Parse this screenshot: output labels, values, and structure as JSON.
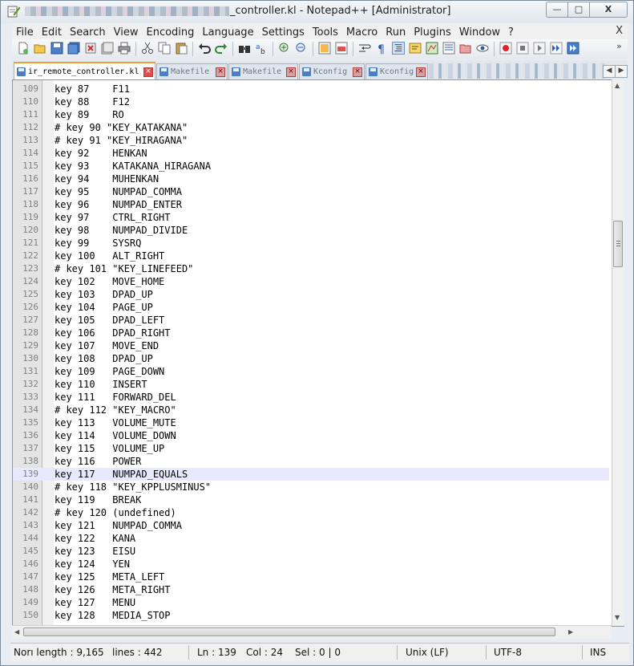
{
  "titlebar": {
    "title_visible": "_controller.kl - Notepad++ [Administrator]",
    "minimize": "—",
    "maximize": "□",
    "close": "X"
  },
  "menu": {
    "items": [
      "File",
      "Edit",
      "Search",
      "View",
      "Encoding",
      "Language",
      "Settings",
      "Tools",
      "Macro",
      "Run",
      "Plugins",
      "Window",
      "?"
    ],
    "close_label": "X"
  },
  "tabs": [
    {
      "label": "ir_remote_controller.kl",
      "active": true
    },
    {
      "label": "Makefile",
      "active": false
    },
    {
      "label": "Makefile",
      "active": false
    },
    {
      "label": "Kconfig",
      "active": false
    },
    {
      "label": "Kconfig",
      "active": false
    }
  ],
  "tab_close_glyph": "×",
  "editor": {
    "current_line": 139,
    "lines": [
      {
        "n": "109",
        "text": "key 87    F11"
      },
      {
        "n": "110",
        "text": "key 88    F12"
      },
      {
        "n": "111",
        "text": "key 89    RO"
      },
      {
        "n": "112",
        "text": "# key 90 \"KEY_KATAKANA\""
      },
      {
        "n": "113",
        "text": "# key 91 \"KEY_HIRAGANA\""
      },
      {
        "n": "114",
        "text": "key 92    HENKAN"
      },
      {
        "n": "115",
        "text": "key 93    KATAKANA_HIRAGANA"
      },
      {
        "n": "116",
        "text": "key 94    MUHENKAN"
      },
      {
        "n": "117",
        "text": "key 95    NUMPAD_COMMA"
      },
      {
        "n": "118",
        "text": "key 96    NUMPAD_ENTER"
      },
      {
        "n": "119",
        "text": "key 97    CTRL_RIGHT"
      },
      {
        "n": "120",
        "text": "key 98    NUMPAD_DIVIDE"
      },
      {
        "n": "121",
        "text": "key 99    SYSRQ"
      },
      {
        "n": "122",
        "text": "key 100   ALT_RIGHT"
      },
      {
        "n": "123",
        "text": "# key 101 \"KEY_LINEFEED\""
      },
      {
        "n": "124",
        "text": "key 102   MOVE_HOME"
      },
      {
        "n": "125",
        "text": "key 103   DPAD_UP"
      },
      {
        "n": "126",
        "text": "key 104   PAGE_UP"
      },
      {
        "n": "127",
        "text": "key 105   DPAD_LEFT"
      },
      {
        "n": "128",
        "text": "key 106   DPAD_RIGHT"
      },
      {
        "n": "129",
        "text": "key 107   MOVE_END"
      },
      {
        "n": "130",
        "text": "key 108   DPAD_UP"
      },
      {
        "n": "131",
        "text": "key 109   PAGE_DOWN"
      },
      {
        "n": "132",
        "text": "key 110   INSERT"
      },
      {
        "n": "133",
        "text": "key 111   FORWARD_DEL"
      },
      {
        "n": "134",
        "text": "# key 112 \"KEY_MACRO\""
      },
      {
        "n": "135",
        "text": "key 113   VOLUME_MUTE"
      },
      {
        "n": "136",
        "text": "key 114   VOLUME_DOWN"
      },
      {
        "n": "137",
        "text": "key 115   VOLUME_UP"
      },
      {
        "n": "138",
        "text": "key 116   POWER"
      },
      {
        "n": "139",
        "text": "key 117   NUMPAD_EQUALS"
      },
      {
        "n": "140",
        "text": "# key 118 \"KEY_KPPLUSMINUS\""
      },
      {
        "n": "141",
        "text": "key 119   BREAK"
      },
      {
        "n": "142",
        "text": "# key 120 (undefined)"
      },
      {
        "n": "143",
        "text": "key 121   NUMPAD_COMMA"
      },
      {
        "n": "144",
        "text": "key 122   KANA"
      },
      {
        "n": "145",
        "text": "key 123   EISU"
      },
      {
        "n": "146",
        "text": "key 124   YEN"
      },
      {
        "n": "147",
        "text": "key 125   META_LEFT"
      },
      {
        "n": "148",
        "text": "key 126   META_RIGHT"
      },
      {
        "n": "149",
        "text": "key 127   MENU"
      },
      {
        "n": "150",
        "text": "key 128   MEDIA_STOP"
      }
    ]
  },
  "statusbar": {
    "length": "Norı length : 9,165",
    "lines": "lines : 442",
    "ln": "Ln : 139",
    "col": "Col : 24",
    "sel": "Sel : 0 | 0",
    "eol": "Unix (LF)",
    "encoding": "UTF-8",
    "mode": "INS"
  },
  "colors": {
    "current_line_bg": "#e8e8ff",
    "active_tab_accent": "#f0a030",
    "line_number": "#808080"
  }
}
